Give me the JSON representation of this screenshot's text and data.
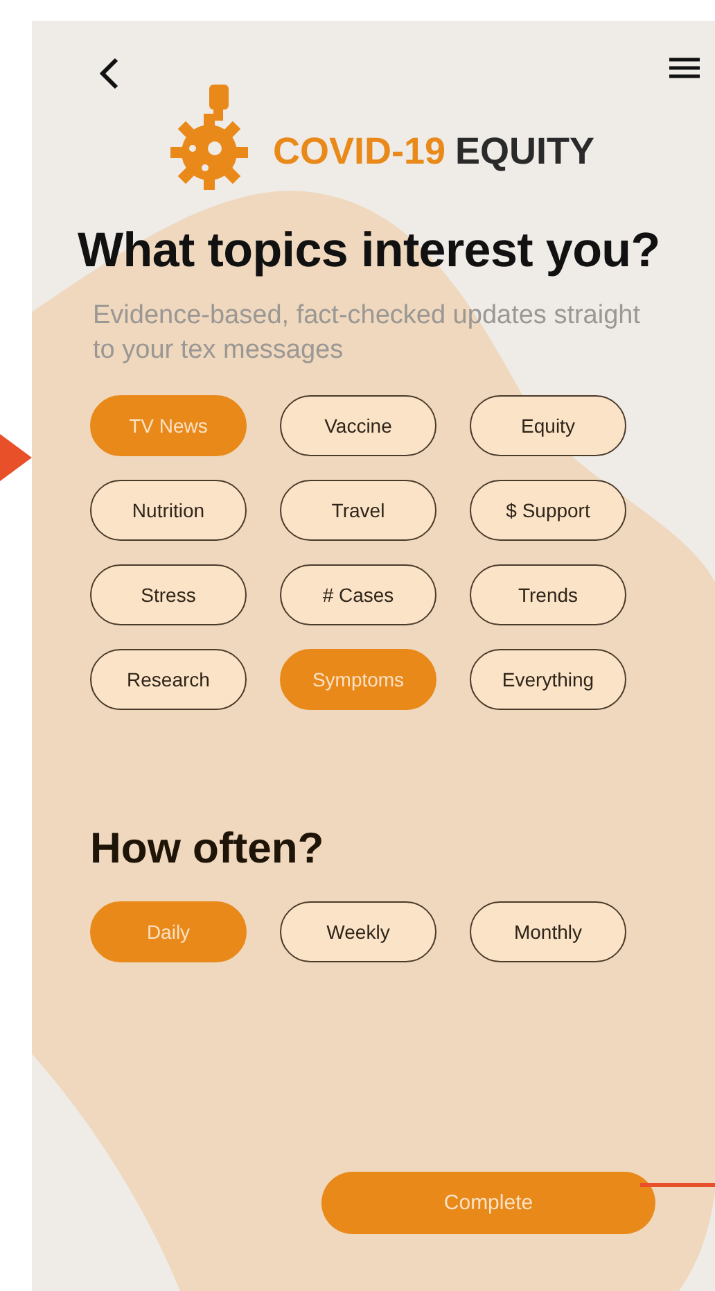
{
  "logo": {
    "brand_primary": "COVID-19",
    "brand_secondary": "EQUITY"
  },
  "heading": "What topics interest you?",
  "subtitle": "Evidence-based, fact-checked updates straight to your tex messages",
  "topics": [
    {
      "label": "TV News",
      "selected": true
    },
    {
      "label": "Vaccine",
      "selected": false
    },
    {
      "label": "Equity",
      "selected": false
    },
    {
      "label": "Nutrition",
      "selected": false
    },
    {
      "label": "Travel",
      "selected": false
    },
    {
      "label": "$ Support",
      "selected": false
    },
    {
      "label": "Stress",
      "selected": false
    },
    {
      "label": "# Cases",
      "selected": false
    },
    {
      "label": "Trends",
      "selected": false
    },
    {
      "label": "Research",
      "selected": false
    },
    {
      "label": "Symptoms",
      "selected": true
    },
    {
      "label": "Everything",
      "selected": false
    }
  ],
  "frequency_heading": "How often?",
  "frequencies": [
    {
      "label": "Daily",
      "selected": true
    },
    {
      "label": "Weekly",
      "selected": false
    },
    {
      "label": "Monthly",
      "selected": false
    }
  ],
  "complete_button": "Complete"
}
